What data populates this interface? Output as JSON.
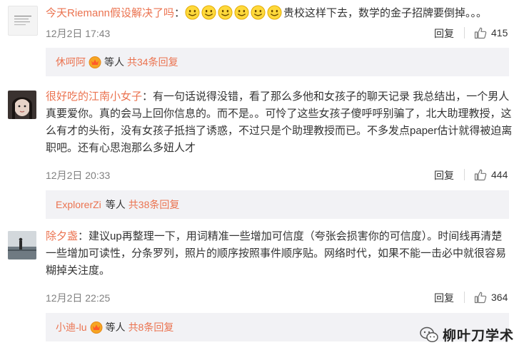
{
  "comments": [
    {
      "user": "今天Riemann假设解决了吗",
      "separator": "：",
      "emoji_count": 6,
      "emoji_name": "smile-emoji",
      "text": "贵校这样下去，数学的金子招牌要倒掉。。。",
      "time": "12月2日 17:43",
      "reply_label": "回复",
      "likes": "415",
      "sub": {
        "user": "休呵阿",
        "etc": "等人",
        "total": "共34条回复"
      }
    },
    {
      "user": "很好吃的江南小女子",
      "separator": "：",
      "text": "有一句话说得没错，看了那么多他和女孩子的聊天记录 我总结出，一个男人真要爱你。真的会马上回你信息的。而不是。。可怜了这些女孩子傻呼呼别骗了，北大助理教授，这么有才的头衔，没有女孩子抵挡了诱惑，不过只是个助理教授而已。不多发点paper估计就得被迫离职吧。还有心思泡那么多妞人才",
      "time": "12月2日 20:33",
      "reply_label": "回复",
      "likes": "444",
      "sub": {
        "user": "ExplorerZi",
        "etc": "等人",
        "total": "共38条回复"
      }
    },
    {
      "user": "除夕盏",
      "separator": "：",
      "text": "建议up再整理一下，用词精准一些增加可信度（夸张会损害你的可信度）。时间线再清楚一些增加可读性，分条罗列，照片的顺序按照事件顺序贴。网络时代，如果不能一击必中就很容易糊掉关注度。",
      "time": "12月2日 22:25",
      "reply_label": "回复",
      "likes": "364",
      "sub": {
        "user": "小迪-lu",
        "etc": "等人",
        "total": "共8条回复"
      }
    }
  ],
  "watermark": "柳叶刀学术",
  "colors": {
    "link": "#eb7350",
    "subbox_bg": "#f2f2f5",
    "meta": "#808080",
    "text": "#333333"
  }
}
